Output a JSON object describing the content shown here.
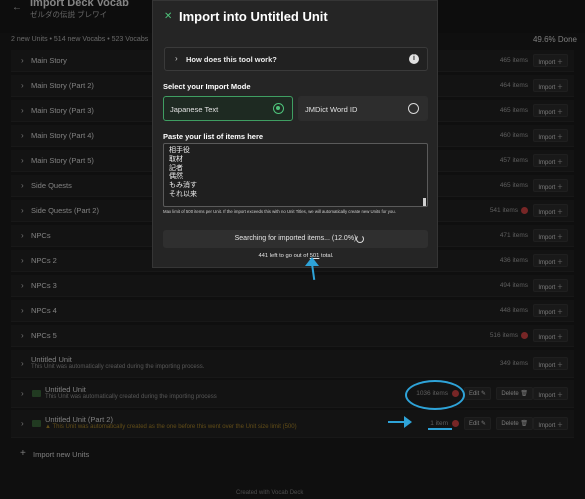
{
  "page": {
    "title": "Import Deck Vocab",
    "subtitle": "ゼルダの伝説 ブレワイ",
    "summary": "2 new Units • 514 new Vocabs • 523 Vocabs",
    "done": "49.6% Done"
  },
  "units": [
    {
      "name": "Main Story",
      "count": "465 items",
      "error": false
    },
    {
      "name": "Main Story (Part 2)",
      "count": "464 items",
      "error": false
    },
    {
      "name": "Main Story (Part 3)",
      "count": "465 items",
      "error": false
    },
    {
      "name": "Main Story (Part 4)",
      "count": "460 items",
      "error": false
    },
    {
      "name": "Main Story (Part 5)",
      "count": "457 items",
      "error": false
    },
    {
      "name": "Side Quests",
      "count": "465 items",
      "error": false
    },
    {
      "name": "Side Quests (Part 2)",
      "count": "541 items",
      "error": true
    },
    {
      "name": "NPCs",
      "count": "471 items",
      "error": false
    },
    {
      "name": "NPCs 2",
      "count": "436 items",
      "error": false
    },
    {
      "name": "NPCs 3",
      "count": "494 items",
      "error": false
    },
    {
      "name": "NPCs 4",
      "count": "448 items",
      "error": false
    },
    {
      "name": "NPCs 5",
      "count": "516 items",
      "error": true
    }
  ],
  "new_units": [
    {
      "name": "Untitled Unit",
      "desc": "This Unit was automatically created during the importing process.",
      "count": "349 items"
    },
    {
      "name": "Untitled Unit",
      "desc": "This Unit was automatically created during the importing process",
      "count": "1036 items"
    },
    {
      "name": "Untitled Unit (Part 2)",
      "desc": "▲ This Unit was automatically created as the one before this went over the Unit size limit (500)",
      "count": "1 item"
    }
  ],
  "buttons": {
    "import": "Import",
    "edit": "Edit",
    "delete": "Delete"
  },
  "import_new": "Import new Units",
  "modal": {
    "title": "Import into Untitled Unit",
    "accordion": "How does this tool work?",
    "mode_label": "Select your Import Mode",
    "modes": [
      "Japanese Text",
      "JMDict Word ID"
    ],
    "paste_label": "Paste your list of items here",
    "items": [
      "相手役",
      "取材",
      "記者",
      "偶然",
      "もみ消す",
      "それ以来"
    ],
    "hint": "Max limit of 500 items per Unit. If the import exceeds this with no Unit Titles, we will automatically create new Units for you.",
    "progress": "Searching for imported items... (12.0%)",
    "left_prefix": "441 left to go out of ",
    "left_total": "501",
    "left_suffix": " total."
  },
  "footer": "Created with Vocab Deck"
}
